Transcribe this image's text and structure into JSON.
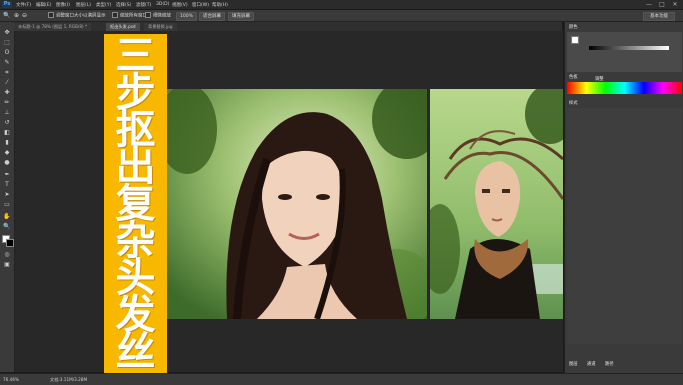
{
  "app": {
    "logo": "Ps"
  },
  "menu": [
    "文件(F)",
    "编辑(E)",
    "图像(I)",
    "图层(L)",
    "类型(Y)",
    "选择(S)",
    "滤镜(T)",
    "3D(D)",
    "视图(V)",
    "窗口(W)",
    "帮助(H)"
  ],
  "window_controls": {
    "minimize": "—",
    "maximize": "□",
    "close": "✕"
  },
  "options": {
    "zoom_icon": "zoom-icon",
    "resize_windows": "调整窗口大小以满屏显示",
    "zoom_all": "缩放所有窗口",
    "scrubby_zoom": "细微缩放",
    "percent": "100%",
    "fit_screen": "适合屏幕",
    "fill_screen": "填充屏幕",
    "workspace": "基本功能"
  },
  "tabs": [
    {
      "label": "未标题-1 @ 78% (图层 1, RGB/8) *",
      "active": false
    },
    {
      "label": "抠出头发.psd",
      "active": true
    },
    {
      "label": "背景替换.jpg",
      "active": false
    }
  ],
  "banner": {
    "title_chars": [
      "三",
      "步",
      "抠",
      "出",
      "复",
      "杂",
      "头",
      "发",
      "丝"
    ]
  },
  "status": {
    "zoom": "76.46%",
    "doc": "文档:3.11M/3.28M"
  },
  "panels": {
    "color_tab": "颜色",
    "swatches_tab": "色板",
    "adjust_tab": "调整",
    "styles_tab": "样式",
    "layers_tab": "图层",
    "channels_tab": "通道",
    "paths_tab": "路径"
  },
  "colors": {
    "banner": "#f8b800",
    "canvas": "#282828",
    "chrome": "#3a3a3a"
  }
}
